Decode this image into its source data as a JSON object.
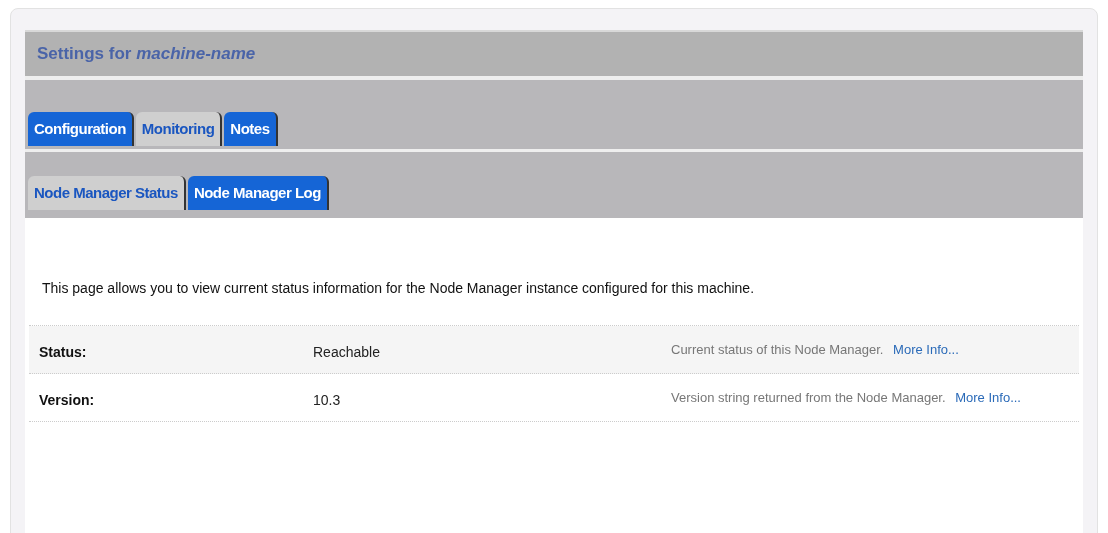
{
  "title": {
    "prefix": "Settings for ",
    "name": "machine-name"
  },
  "tabs": [
    {
      "label": "Configuration",
      "selected": false
    },
    {
      "label": "Monitoring",
      "selected": true
    },
    {
      "label": "Notes",
      "selected": false
    }
  ],
  "subtabs": [
    {
      "label": "Node Manager Status",
      "selected": true
    },
    {
      "label": "Node Manager Log",
      "selected": false
    }
  ],
  "description": "This page allows you to view current status information for the Node Manager instance configured for this machine.",
  "rows": [
    {
      "label": "Status:",
      "value": "Reachable",
      "help": "Current status of this Node Manager.",
      "link": "More Info..."
    },
    {
      "label": "Version:",
      "value": "10.3",
      "help": "Version string returned from the Node Manager.",
      "link": "More Info..."
    }
  ]
}
